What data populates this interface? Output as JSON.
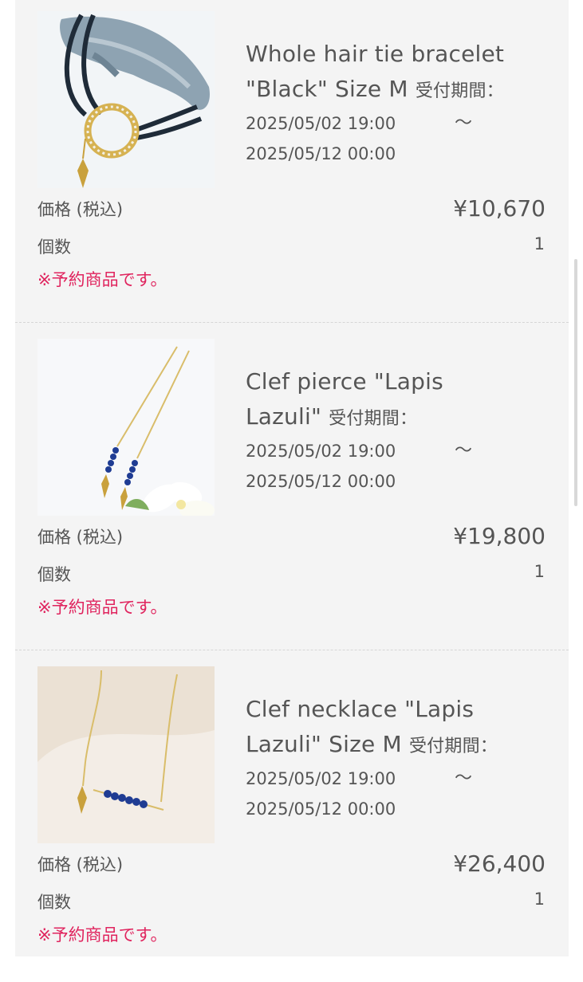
{
  "items": [
    {
      "name": "Whole hair tie bracelet \"Black\" Size M",
      "title_line1": "Whole hair tie bracelet",
      "title_line2": "\"Black\" Size M",
      "period_label": "受付期間：",
      "start": "2025/05/02 19:00",
      "tilde": "～",
      "end": "2025/05/12 00:00",
      "price_label": "価格 (税込)",
      "price": "¥10,670",
      "qty_label": "個数",
      "qty": "1",
      "note": "※予約商品です。"
    },
    {
      "name": "Clef pierce \"Lapis Lazuli\"",
      "title_line1": "Clef pierce \"Lapis",
      "title_line2": "Lazuli\"",
      "period_label": "受付期間：",
      "start": "2025/05/02 19:00",
      "tilde": "～",
      "end": "2025/05/12 00:00",
      "price_label": "価格 (税込)",
      "price": "¥19,800",
      "qty_label": "個数",
      "qty": "1",
      "note": "※予約商品です。"
    },
    {
      "name": "Clef necklace \"Lapis Lazuli\" Size M",
      "title_line1": "Clef necklace \"Lapis",
      "title_line2": "Lazuli\" Size M",
      "period_label": "受付期間：",
      "start": "2025/05/02 19:00",
      "tilde": "～",
      "end": "2025/05/12 00:00",
      "price_label": "価格 (税込)",
      "price": "¥26,400",
      "qty_label": "個数",
      "qty": "1",
      "note": "※予約商品です。"
    }
  ],
  "colors": {
    "note": "#e0245e",
    "panel": "#f4f4f4",
    "text": "#555555"
  }
}
